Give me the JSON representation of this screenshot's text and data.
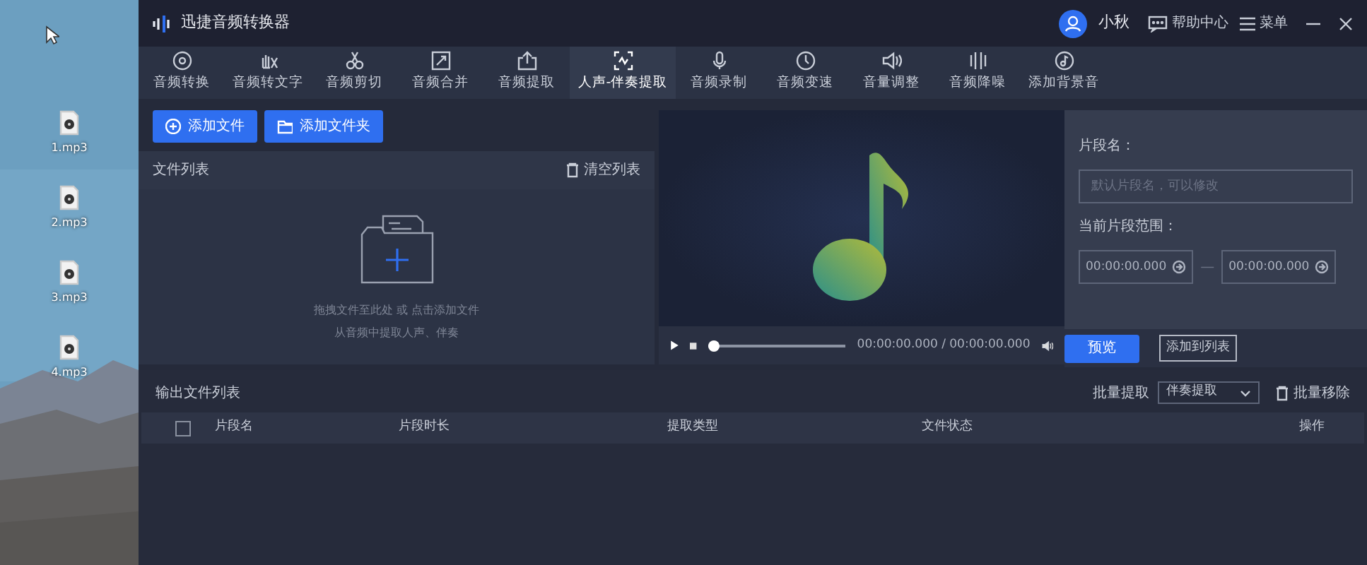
{
  "desktop": {
    "icons": [
      {
        "label": "1.mp3"
      },
      {
        "label": "2.mp3"
      },
      {
        "label": "3.mp3"
      },
      {
        "label": "4.mp3"
      }
    ]
  },
  "window": {
    "title": "迅捷音频转换器",
    "user": "小秋",
    "help": "帮助中心",
    "menu": "菜单"
  },
  "tabs": [
    {
      "label": "音频转换",
      "selected": false
    },
    {
      "label": "音频转文字",
      "selected": false
    },
    {
      "label": "音频剪切",
      "selected": false
    },
    {
      "label": "音频合并",
      "selected": false
    },
    {
      "label": "音频提取",
      "selected": false
    },
    {
      "label": "人声-伴奏提取",
      "selected": true
    },
    {
      "label": "音频录制",
      "selected": false
    },
    {
      "label": "音频变速",
      "selected": false
    },
    {
      "label": "音量调整",
      "selected": false
    },
    {
      "label": "音频降噪",
      "selected": false
    },
    {
      "label": "添加背景音",
      "selected": false
    }
  ],
  "input": {
    "buttons": [
      "添加文件",
      "添加文件夹"
    ],
    "list_title": "文件列表",
    "clear": "清空列表",
    "hint": [
      "拖拽文件至此处 或 点击添加文件",
      "从音频中提取人声、伴奏"
    ]
  },
  "player": {
    "progress": {
      "level": 0
    },
    "time": "00:00:00.000 / 00:00:00.000",
    "preview": "预览",
    "add_to_list": "添加到列表"
  },
  "segment": {
    "name_label": "片段名：",
    "name_placeholder": "默认片段名，可以修改",
    "range_label": "当前片段范围：",
    "start": "00:00:00.000",
    "separator": "—",
    "end": "00:00:00.000"
  },
  "output": {
    "title": "输出文件列表",
    "batch_label": "批量提取",
    "batch_value": "伴奏提取",
    "remove": "批量移除",
    "select_all": {
      "checked": false
    },
    "columns": [
      "片段名",
      "片段时长",
      "提取类型",
      "文件状态",
      "操作"
    ]
  }
}
